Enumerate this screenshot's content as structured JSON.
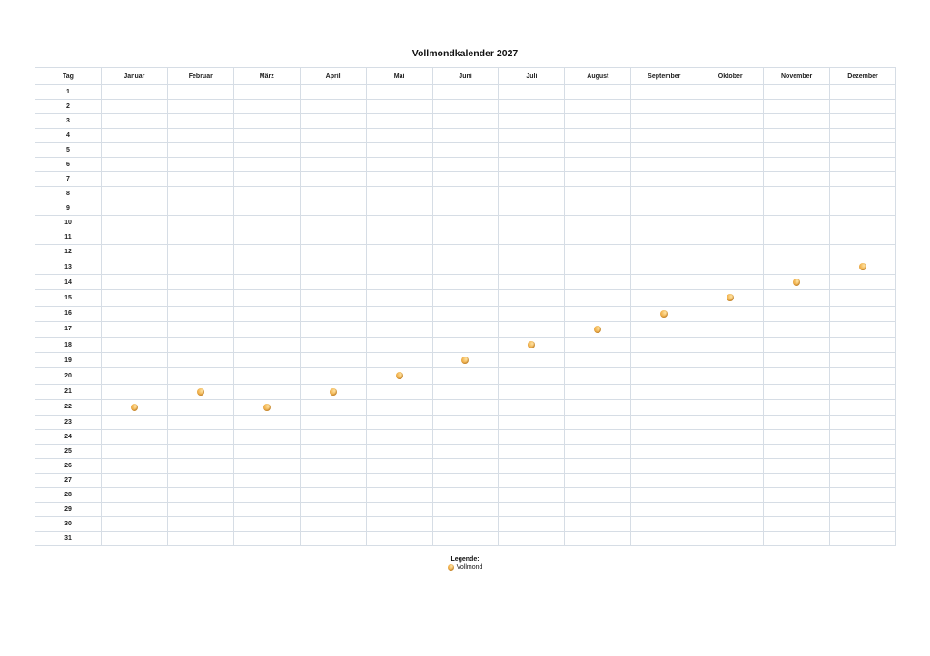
{
  "title": "Vollmondkalender 2027",
  "day_header": "Tag",
  "months": [
    "Januar",
    "Februar",
    "März",
    "April",
    "Mai",
    "Juni",
    "Juli",
    "August",
    "September",
    "Oktober",
    "November",
    "Dezember"
  ],
  "days": [
    "1",
    "2",
    "3",
    "4",
    "5",
    "6",
    "7",
    "8",
    "9",
    "10",
    "11",
    "12",
    "13",
    "14",
    "15",
    "16",
    "17",
    "18",
    "19",
    "20",
    "21",
    "22",
    "23",
    "24",
    "25",
    "26",
    "27",
    "28",
    "29",
    "30",
    "31"
  ],
  "full_moons": [
    {
      "month": "Januar",
      "day": 22
    },
    {
      "month": "Februar",
      "day": 21
    },
    {
      "month": "März",
      "day": 22
    },
    {
      "month": "April",
      "day": 21
    },
    {
      "month": "Mai",
      "day": 20
    },
    {
      "month": "Juni",
      "day": 19
    },
    {
      "month": "Juli",
      "day": 18
    },
    {
      "month": "August",
      "day": 17
    },
    {
      "month": "September",
      "day": 16
    },
    {
      "month": "Oktober",
      "day": 15
    },
    {
      "month": "November",
      "day": 14
    },
    {
      "month": "Dezember",
      "day": 13
    }
  ],
  "legend": {
    "title": "Legende:",
    "items": [
      {
        "icon": "full-moon-icon",
        "label": "Vollmond"
      }
    ]
  },
  "colors": {
    "grid": "#d6dde5",
    "moon": "#f2b450"
  }
}
